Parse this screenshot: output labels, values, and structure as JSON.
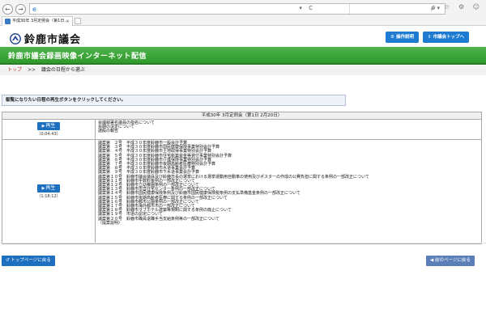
{
  "browser": {
    "tab_title": "平成30年 3月定例会（第1日…",
    "nav_back": "←",
    "nav_forward": "→",
    "address_controls": "▾ C",
    "search_controls": "ρ▾",
    "toolbar_icons": "⌂ ☆ ⚙ ☺"
  },
  "header": {
    "site_name": "鈴鹿市議会",
    "help_button": "操作説明",
    "top_button": "市議会トップへ",
    "help_icon": "⚙",
    "top_icon": "⇧"
  },
  "banner": {
    "title": "鈴鹿市議会録画映像インターネット配信"
  },
  "breadcrumb": {
    "top": "トップ",
    "sep": ">>",
    "current": "議会の日程から選ぶ"
  },
  "instruction": "御覧になりたい日程の再生ボタンをクリックしてください。",
  "session": {
    "title": "平成30年 3月定例会（第1日 2月20日）",
    "rows": [
      {
        "play_label": "再生",
        "duration": "（0:04:43）",
        "items": [
          "会議録署名議員の指名について",
          "会期の決定について",
          "諸般の報告"
        ]
      },
      {
        "play_label": "再生",
        "duration": "（1:18:12）",
        "items": [
          "議案第　２号　平成３０年度鈴鹿市一般会計予算",
          "議案第　３号　平成３０年度鈴鹿市国民健康保険事業特別会計予算",
          "議案第　４号　平成３０年度鈴鹿市土地取得事業特別会計予算",
          "議案第　５号　平成３０年度鈴鹿市住宅新築資金等貸付事業特別会計予算",
          "議案第　６号　平成３０年度鈴鹿市介護保険事業特別会計予算",
          "議案第　７号　平成３０年度鈴鹿市後期高齢者医療特別会計予算",
          "議案第　８号　平成３０年度鈴鹿市水道事業会計予算",
          "議案第　９号　平成３０年度鈴鹿市下水道事業会計予算",
          "議案第１０号　鈴鹿市議会議員及び鈴鹿市長の選挙における選挙運動用自動車の使用及びポスターの作成の公費負担に関する条例の一部改正について",
          "議案第１１号　鈴鹿市手数料条例の一部改正について",
          "議案第１２号　鈴鹿市立幼稚園条例の一部改正について",
          "議案第１３号　鈴鹿市市営住宅センター条例の一部改正について",
          "議案第１４号　鈴鹿市国民健康保険条例及び鈴鹿市国民健康保険税条例の支払準備基金条例の一部改正について",
          "議案第１５号　鈴鹿市後期高齢者医療に関する条例の一部改正について",
          "議案第１６号　鈴鹿市都市公園条例の一部改正について",
          "議案第１７号　鈴鹿市海外都市市の一部改正について",
          "議案第１８号　鈴鹿市ラブホテル建築等規制に関する条例の廃止について",
          "議案第１９号　市道の認定について",
          "議案第２０号　鈴鹿市職員退職手当支給条例等の一部改正について",
          "（提案説明）"
        ]
      }
    ]
  },
  "footer": {
    "top_page_button": "トップページに戻る",
    "back_button": "前のページに戻る",
    "top_page_icon": "↺",
    "back_icon": "◀"
  },
  "colors": {
    "accent_blue": "#1d7bd1",
    "banner_green": "#3da638",
    "crumb_red": "#c0392b"
  }
}
